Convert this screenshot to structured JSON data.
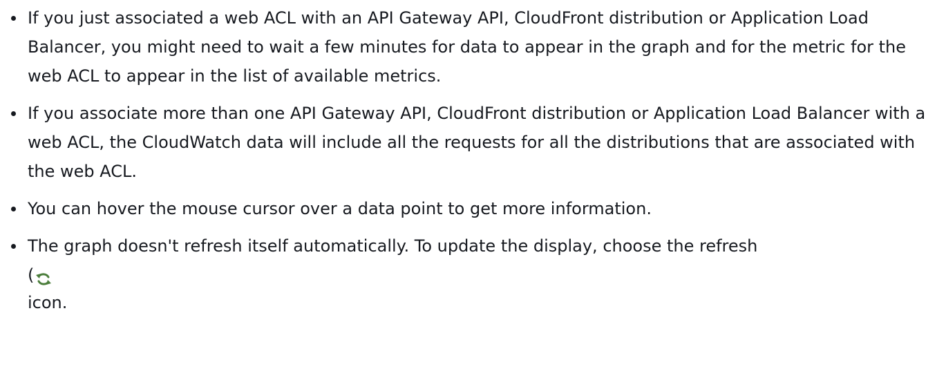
{
  "notes": [
    {
      "text": "If you just associated a web ACL with an API Gateway API, CloudFront distribution or Application Load Balancer, you might need to wait a few minutes for data to appear in the graph and for the metric for the web ACL to appear in the list of available metrics."
    },
    {
      "text": "If you associate more than one API Gateway API, CloudFront distribution or Application Load Balancer with a web ACL, the CloudWatch data will include all the requests for all the distributions that are associated with the web ACL."
    },
    {
      "text": "You can hover the mouse cursor over a data point to get more information."
    },
    {
      "text": "The graph doesn't refresh itself automatically. To update the display, choose the refresh",
      "paren": "(",
      "icon": "refresh-icon",
      "tail": "icon."
    }
  ]
}
